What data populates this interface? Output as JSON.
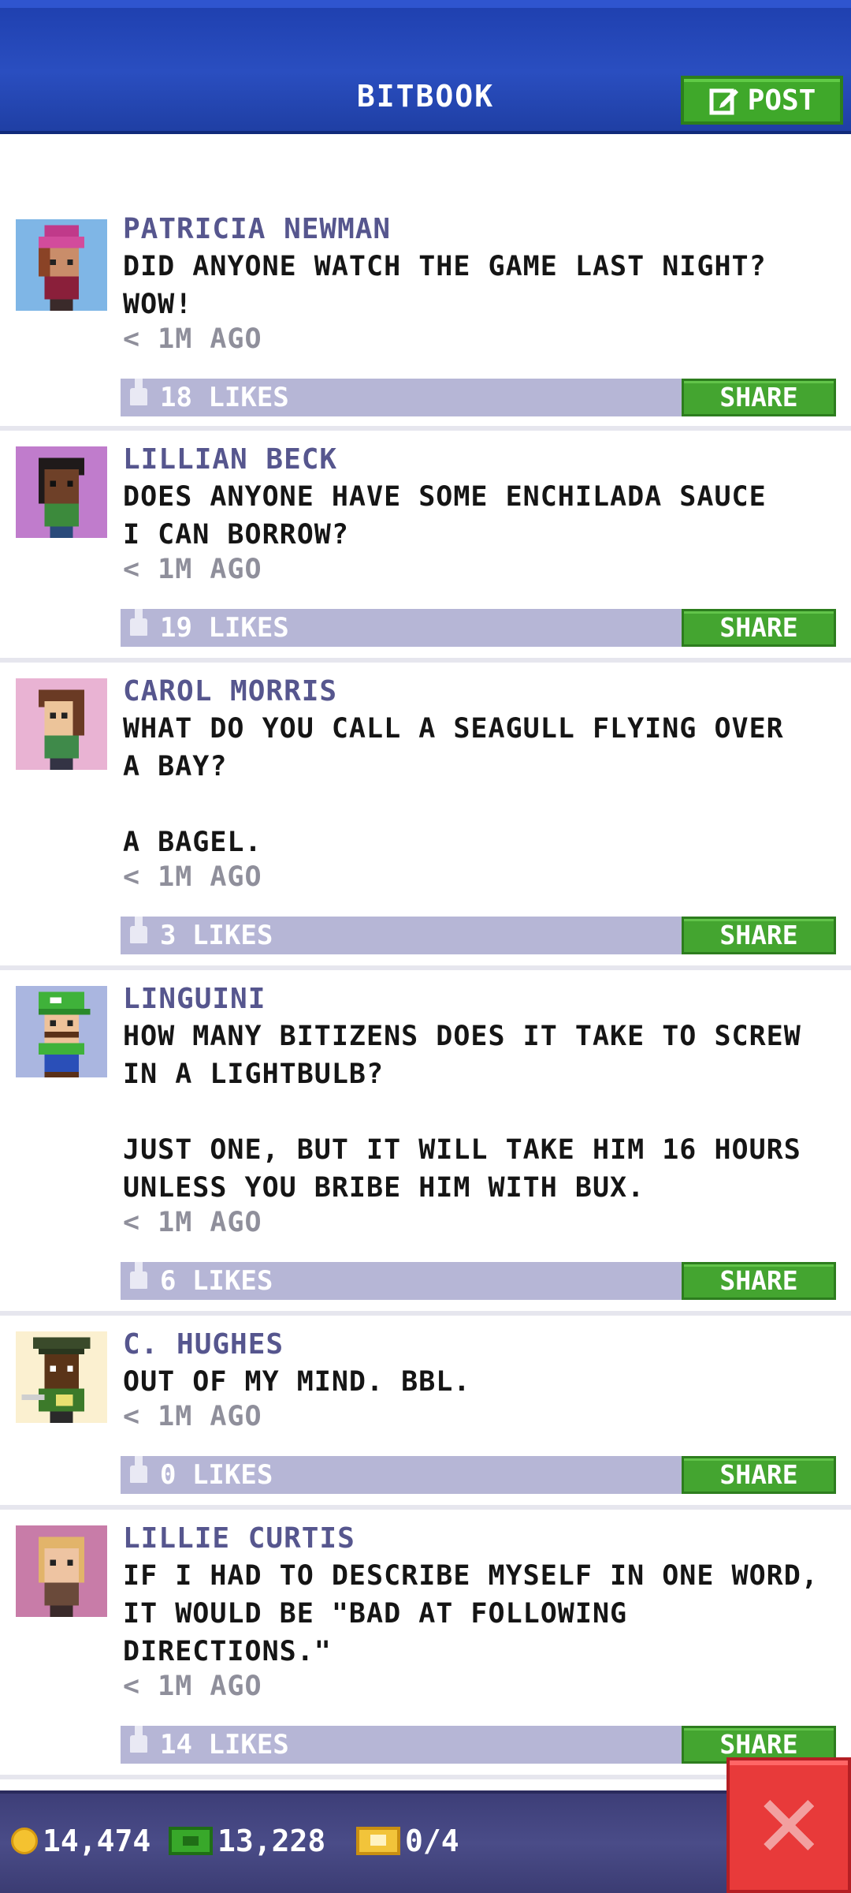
{
  "header": {
    "title": "BITBOOK",
    "post_label": "POST"
  },
  "posts": [
    {
      "name": "PATRICIA NEWMAN",
      "message": "DID ANYONE WATCH THE GAME LAST NIGHT?\nWOW!",
      "time": "< 1M AGO",
      "likes": "18 LIKES",
      "share": "SHARE"
    },
    {
      "name": "LILLIAN BECK",
      "message": "DOES ANYONE HAVE SOME ENCHILADA SAUCE\nI CAN BORROW?",
      "time": "< 1M AGO",
      "likes": "19 LIKES",
      "share": "SHARE"
    },
    {
      "name": "CAROL MORRIS",
      "message": "WHAT DO YOU CALL A SEAGULL FLYING OVER\nA BAY?\n\nA BAGEL.",
      "time": "< 1M AGO",
      "likes": "3 LIKES",
      "share": "SHARE"
    },
    {
      "name": "LINGUINI",
      "message": "HOW MANY BITIZENS DOES IT TAKE TO SCREW\nIN A LIGHTBULB?\n\nJUST ONE, BUT IT WILL TAKE HIM 16 HOURS\nUNLESS YOU BRIBE HIM WITH BUX.",
      "time": "< 1M AGO",
      "likes": "6 LIKES",
      "share": "SHARE"
    },
    {
      "name": "C. HUGHES",
      "message": "OUT OF MY MIND. BBL.",
      "time": "< 1M AGO",
      "likes": "0 LIKES",
      "share": "SHARE"
    },
    {
      "name": "LILLIE CURTIS",
      "message": "IF I HAD TO DESCRIBE MYSELF IN ONE WORD,\nIT WOULD BE \"BAD AT FOLLOWING\nDIRECTIONS.\"",
      "time": "< 1M AGO",
      "likes": "14 LIKES",
      "share": "SHARE"
    }
  ],
  "footer": {
    "coins": "14,474",
    "bux": "13,228",
    "tickets": "0/4"
  },
  "icons": {
    "post": "edit-icon",
    "coin": "coin-icon",
    "bux": "bux-icon",
    "ticket": "ticket-icon",
    "close": "close-icon"
  }
}
